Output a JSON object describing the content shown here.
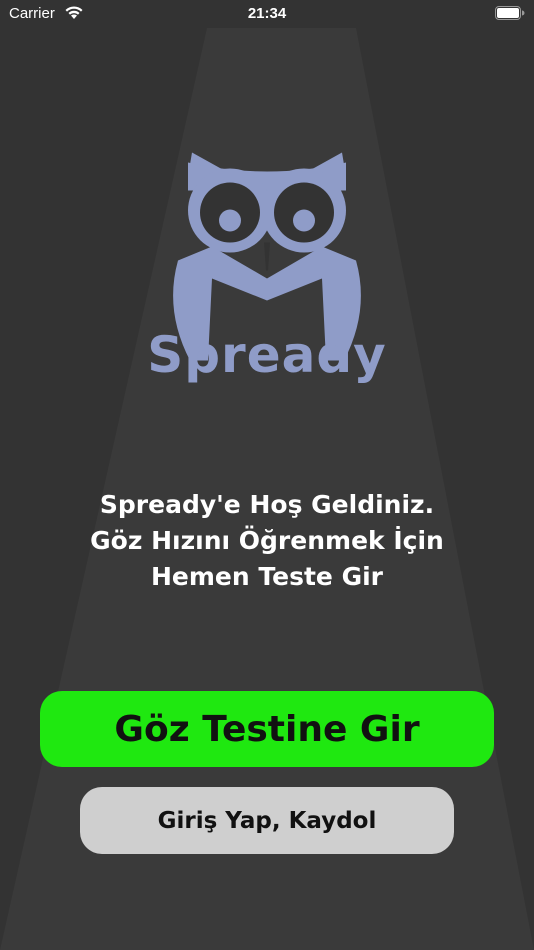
{
  "status_bar": {
    "carrier": "Carrier",
    "time": "21:34",
    "wifi_icon": "wifi-icon",
    "battery_icon": "battery-icon"
  },
  "logo": {
    "icon": "owl-icon",
    "color": "#8f9cc8",
    "brand_name": "Spready"
  },
  "welcome": {
    "line1": "Spready'e Hoş Geldiniz.",
    "line2": "Göz Hızını Öğrenmek İçin",
    "line3": "Hemen Teste Gir"
  },
  "buttons": {
    "primary_label": "Göz Testine Gir",
    "primary_color": "#1fe810",
    "secondary_label": "Giriş Yap, Kaydol",
    "secondary_color": "#cfcfcf"
  },
  "background_color": "#333333"
}
